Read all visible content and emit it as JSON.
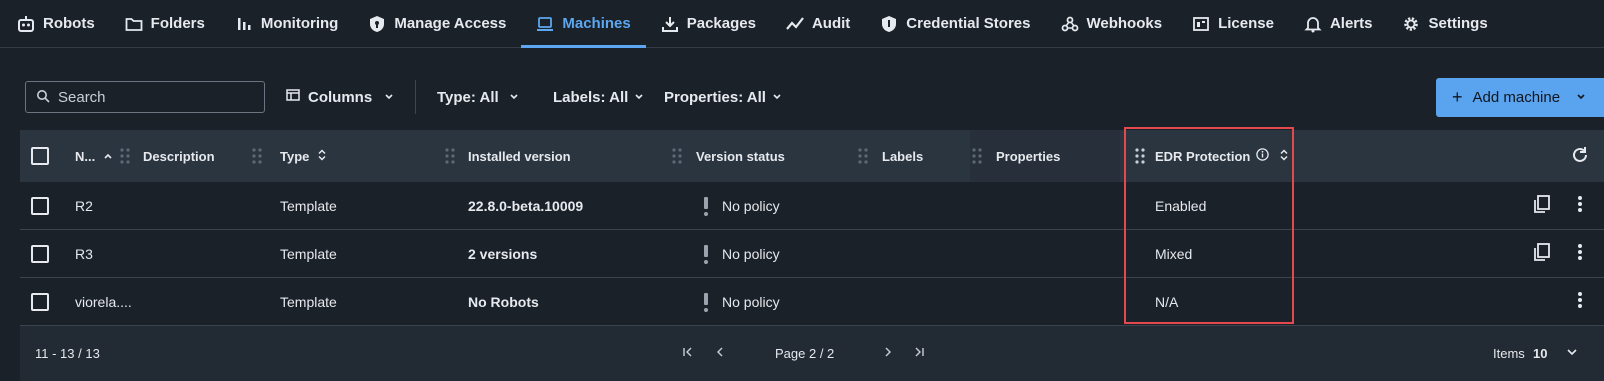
{
  "nav": {
    "items": [
      {
        "label": "Robots",
        "icon": "robot-icon"
      },
      {
        "label": "Folders",
        "icon": "folder-icon"
      },
      {
        "label": "Monitoring",
        "icon": "bar-chart-icon"
      },
      {
        "label": "Manage Access",
        "icon": "shield-icon"
      },
      {
        "label": "Machines",
        "icon": "laptop-icon",
        "active": true
      },
      {
        "label": "Packages",
        "icon": "download-icon"
      },
      {
        "label": "Audit",
        "icon": "trend-line-icon"
      },
      {
        "label": "Credential Stores",
        "icon": "shield-icon"
      },
      {
        "label": "Webhooks",
        "icon": "webhook-icon"
      },
      {
        "label": "License",
        "icon": "license-icon"
      },
      {
        "label": "Alerts",
        "icon": "bell-icon"
      },
      {
        "label": "Settings",
        "icon": "gear-icon"
      }
    ],
    "active_color": "#5da6f0"
  },
  "toolbar": {
    "search_placeholder": "Search",
    "columns_label": "Columns",
    "type_filter": "Type: All",
    "labels_filter": "Labels: All",
    "properties_filter": "Properties: All",
    "add_label": "Add machine",
    "accent": "#5aa3ee"
  },
  "table": {
    "headers": {
      "name": "N...",
      "description": "Description",
      "type": "Type",
      "installed_version": "Installed version",
      "version_status": "Version status",
      "labels": "Labels",
      "properties": "Properties",
      "edr": "EDR Protection"
    },
    "rows": [
      {
        "name": "R2",
        "type": "Template",
        "installed_version": "22.8.0-beta.10009",
        "version_status": "No policy",
        "edr": "Enabled",
        "has_copy": true
      },
      {
        "name": "R3",
        "type": "Template",
        "installed_version": "2 versions",
        "version_status": "No policy",
        "edr": "Mixed",
        "has_copy": true
      },
      {
        "name": "viorela....",
        "type": "Template",
        "installed_version": "No Robots",
        "version_status": "No policy",
        "edr": "N/A",
        "has_copy": false
      }
    ]
  },
  "footer": {
    "range": "11 - 13 / 13",
    "page": "Page 2 / 2",
    "items_label": "Items",
    "items_value": "10"
  },
  "highlight_color": "#e5484d"
}
